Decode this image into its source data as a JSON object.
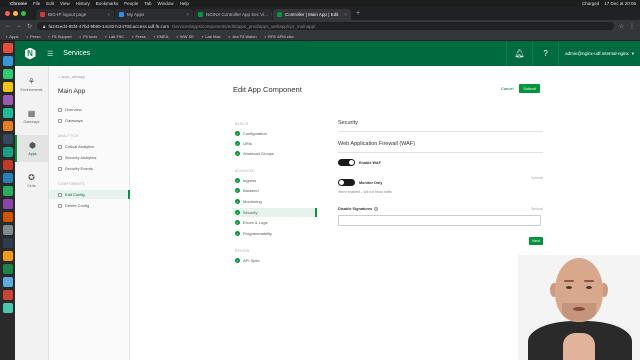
{
  "macos": {
    "app": "Chrome",
    "menus": [
      "File",
      "Edit",
      "View",
      "History",
      "Bookmarks",
      "People",
      "Tab",
      "Window",
      "Help"
    ],
    "status": [
      "Charged",
      "17 Dec at 20:06"
    ]
  },
  "browser": {
    "tabs": [
      {
        "label": "BIG-IP logout page",
        "active": false
      },
      {
        "label": "My Apps",
        "active": false
      },
      {
        "label": "NGINX Controller App Sec Vi...",
        "active": false
      },
      {
        "label": "Controller | Main App | Edit",
        "active": true
      }
    ],
    "url": "fa241ed4-85f4-47bd-9b90-14c827c2470d.access.udf.f5.com",
    "url_path": "/services/apps/components/edit/apps_prod/apps_webapp/cpr_mainapp/",
    "bookmarks": [
      "Apps",
      "Perso",
      "F5 Support",
      "F5 tools",
      "Lab F5C",
      "Press",
      "EMEA",
      "WW SE",
      "Lab Mac",
      "Jira F5 Watch",
      "RFE APM.xlsx"
    ]
  },
  "header": {
    "logo": "N",
    "title": "Services",
    "user": "admin@nginx-udf.internal-nginx"
  },
  "rail": [
    {
      "label": "Environments",
      "icon": "shield-icon",
      "glyph": "⚘"
    },
    {
      "label": "Gateways",
      "icon": "gateways-icon",
      "glyph": "▦"
    },
    {
      "label": "Apps",
      "icon": "apps-icon",
      "glyph": "⬢",
      "active": true
    },
    {
      "label": "Certs",
      "icon": "certs-icon",
      "glyph": "✪"
    }
  ],
  "subnav": {
    "crumb": "⌂ apps_webapp",
    "title": "Main App",
    "items_top": [
      "Overview",
      "Gateways"
    ],
    "section_analytics": "ANALYTICS",
    "items_analytics": [
      "Critical Analytics",
      "Security Analytics",
      "Security Events"
    ],
    "section_components": "COMPONENTS",
    "items_components": [
      "Edit Config",
      "Delete Config"
    ]
  },
  "main": {
    "title": "Edit App Component",
    "cancel": "Cancel",
    "submit": "Submit",
    "steps": {
      "section_basics": "BASICS",
      "basics": [
        "Configuration",
        "URIs",
        "Workload Groups"
      ],
      "section_advanced": "ADVANCED",
      "advanced": [
        "Ingress",
        "Backend",
        "Monitoring",
        "Security",
        "Errors & Logs",
        "Programmability"
      ],
      "section_review": "REVIEW",
      "review": [
        "API Spec"
      ]
    },
    "form": {
      "security_title": "Security",
      "waf_title": "Web Application Firewall (WAF)",
      "enable_waf": "Enable WAF",
      "optional": "Optional",
      "monitor_only": "Monitor Only",
      "monitor_hint": "When enabled – will not block traffic.",
      "disable_signatures": "Disable Signatures",
      "info": "?",
      "next": "Next"
    }
  }
}
